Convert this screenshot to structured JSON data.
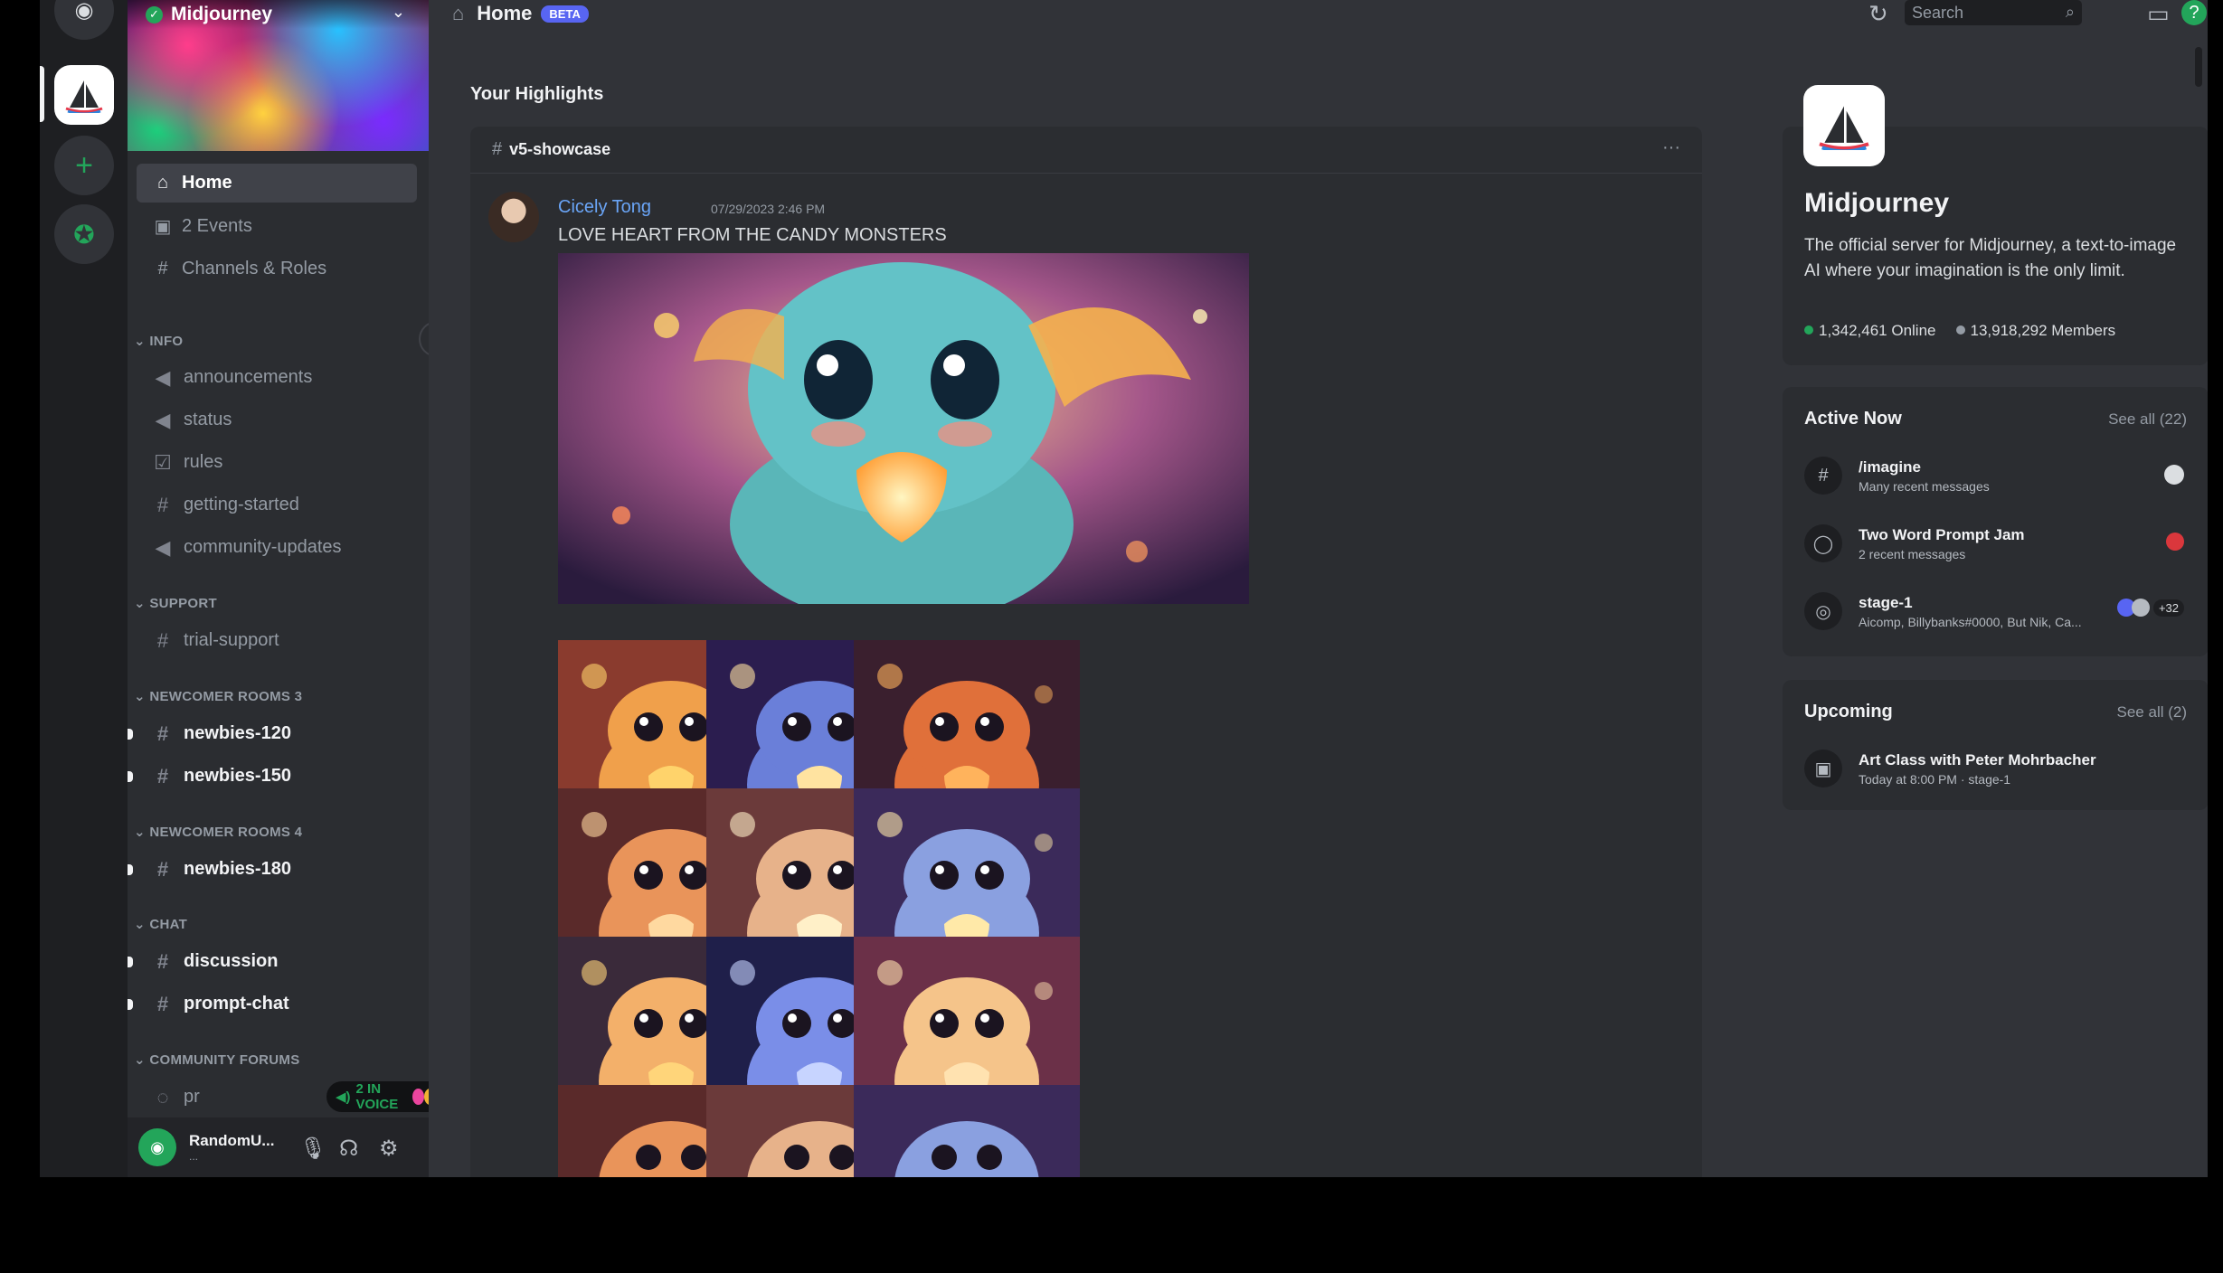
{
  "server": {
    "name": "Midjourney",
    "description": "The official server for Midjourney, a text-to-image AI where your imagination is the only limit.",
    "online": "1,342,461 Online",
    "members": "13,918,292 Members"
  },
  "colors": {
    "background": "#313338",
    "sidebar": "#2b2d31",
    "rail": "#1e1f22",
    "accent": "#5865f2",
    "online_green": "#23a55a",
    "link_blue": "#6aa5f7"
  },
  "sidebar": {
    "nav": [
      {
        "label": "Home",
        "icon": "home-icon"
      },
      {
        "label": "2 Events",
        "icon": "calendar-icon"
      },
      {
        "label": "Channels & Roles",
        "icon": "hashtag-list-icon"
      }
    ],
    "categories": {
      "info": "INFO",
      "support": "SUPPORT",
      "newcomer3": "NEWCOMER ROOMS 3",
      "newcomer4": "NEWCOMER ROOMS 4",
      "chat": "CHAT",
      "forums": "COMMUNITY FORUMS"
    },
    "channels": {
      "announcements": "announcements",
      "status": "status",
      "rules": "rules",
      "getting_started": "getting-started",
      "community_updates": "community-updates",
      "trial_support": "trial-support",
      "newbies_120": "newbies-120",
      "newbies_150": "newbies-150",
      "newbies_180": "newbies-180",
      "discussion": "discussion",
      "prompt_chat": "prompt-chat",
      "forum_partial": "pr"
    },
    "voice_pill": "2 IN VOICE"
  },
  "user": {
    "name": "RandomU...",
    "status": "..."
  },
  "topbar": {
    "title": "Home",
    "badge": "BETA",
    "search_placeholder": "Search"
  },
  "main": {
    "section_title": "Your Highlights",
    "post": {
      "channel": "v5-showcase",
      "author": "Cicely Tong",
      "timestamp": "07/29/2023 2:46 PM",
      "text": "LOVE HEART FROM THE CANDY MONSTERS"
    }
  },
  "active_now": {
    "title": "Active Now",
    "see_all": "See all (22)",
    "items": [
      {
        "title": "/imagine",
        "sub": "Many recent messages",
        "icon": "hashtag-icon"
      },
      {
        "title": "Two Word Prompt Jam",
        "sub": "2 recent messages",
        "icon": "thread-icon"
      },
      {
        "title": "stage-1",
        "sub": "Aicomp, Billybanks#0000, But Nik, Ca...",
        "icon": "stage-icon",
        "extra": "+32"
      }
    ]
  },
  "upcoming": {
    "title": "Upcoming",
    "see_all": "See all (2)",
    "items": [
      {
        "title": "Art Class with Peter Mohrbacher",
        "sub": "Today at 8:00 PM · stage-1",
        "icon": "calendar-icon"
      }
    ]
  }
}
